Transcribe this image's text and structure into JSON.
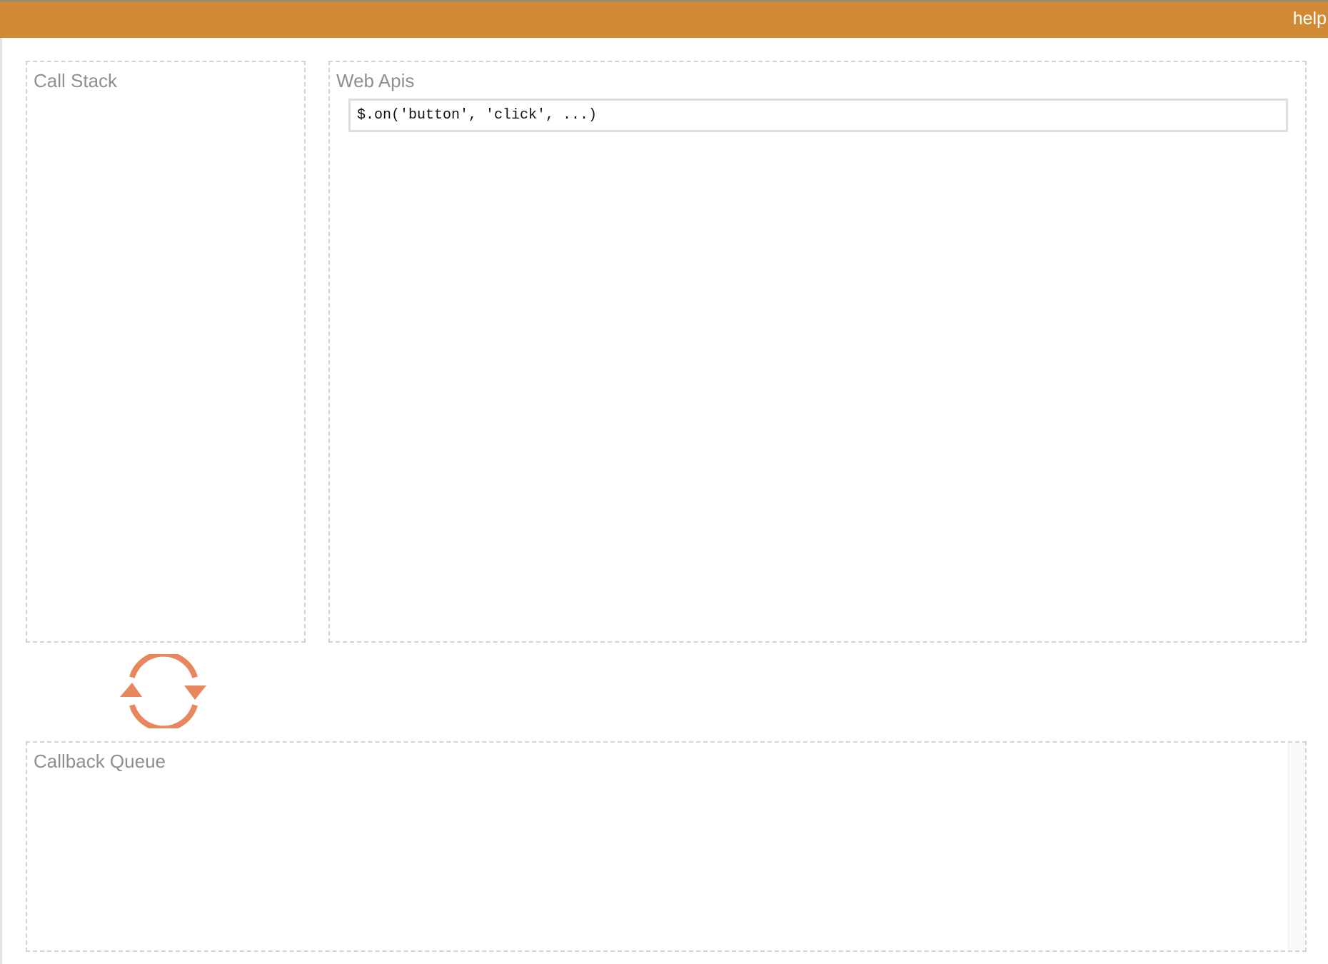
{
  "header": {
    "help_label": "help",
    "background_color": "#cf8a33"
  },
  "call_stack": {
    "title": "Call Stack"
  },
  "web_apis": {
    "title": "Web Apis",
    "items": [
      "$.on('button', 'click', ...)"
    ]
  },
  "event_loop": {
    "icon": "event-loop-refresh-icon",
    "color": "#e8865d"
  },
  "callback_queue": {
    "title": "Callback Queue",
    "items": []
  }
}
